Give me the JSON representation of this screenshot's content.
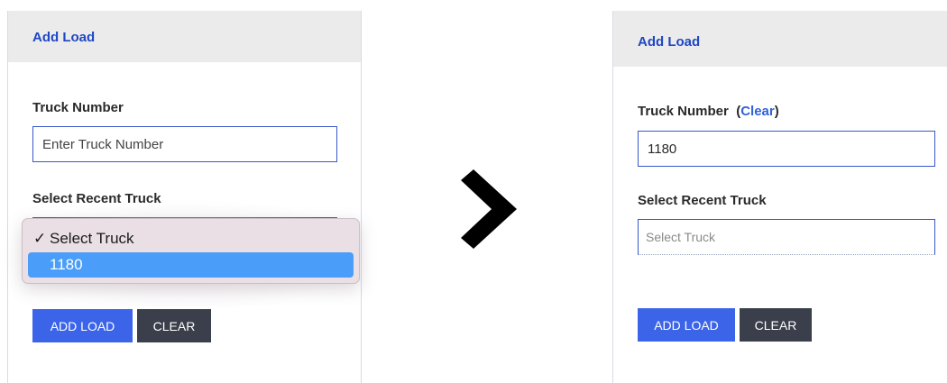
{
  "before": {
    "header_title": "Add Load",
    "truck_number_label": "Truck Number",
    "truck_number_placeholder": "Enter Truck Number",
    "truck_number_value": "",
    "recent_truck_label": "Select Recent Truck",
    "dropdown_options": [
      {
        "label": "Select Truck",
        "checked": true
      },
      {
        "label": "1180",
        "highlighted": true
      }
    ],
    "check_mark": "✓",
    "add_button": "ADD LOAD",
    "clear_button": "CLEAR"
  },
  "after": {
    "header_title": "Add Load",
    "truck_number_label": "Truck Number",
    "clear_link_open": "(",
    "clear_link": "Clear",
    "clear_link_close": ")",
    "truck_number_value": "1180",
    "recent_truck_label": "Select Recent Truck",
    "select_value": "Select Truck",
    "add_button": "ADD LOAD",
    "clear_button": "CLEAR"
  },
  "icons": {
    "transition": "chevron-right-icon"
  },
  "colors": {
    "header_title": "#1f47c2",
    "input_border": "#3858c9",
    "primary_button": "#3c64e8",
    "dark_button": "#3a3f4b",
    "highlight": "#4a9df8",
    "link": "#2f62d9"
  }
}
